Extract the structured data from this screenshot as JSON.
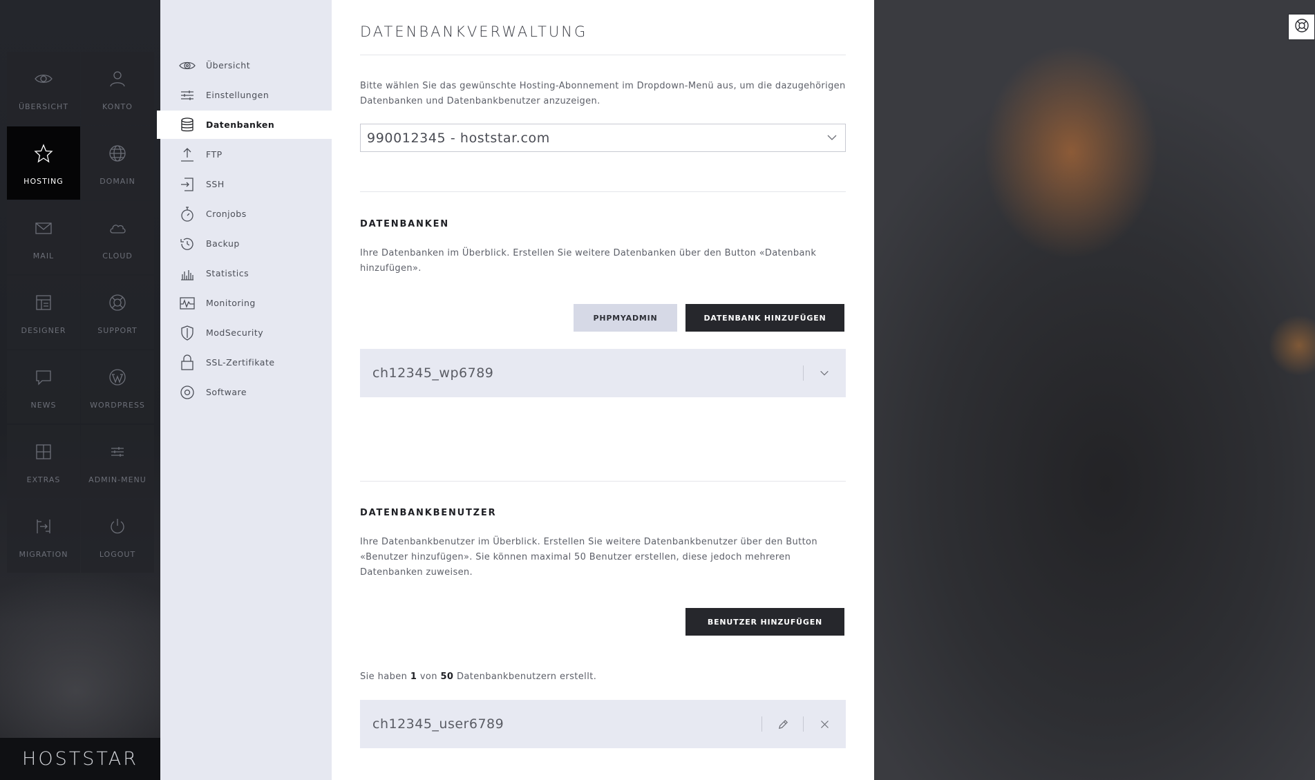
{
  "colors": {
    "accent_dark": "#26272c",
    "submenu_bg": "#e6e8f1",
    "row_bg": "#e7e9f2",
    "button_light": "#d6d9e6"
  },
  "nav": {
    "tiles": [
      {
        "label": "ÜBERSICHT",
        "icon": "eye-icon"
      },
      {
        "label": "KONTO",
        "icon": "user-icon"
      },
      {
        "label": "HOSTING",
        "icon": "star-icon",
        "active": true
      },
      {
        "label": "DOMAIN",
        "icon": "globe-icon"
      },
      {
        "label": "MAIL",
        "icon": "envelope-icon"
      },
      {
        "label": "CLOUD",
        "icon": "cloud-icon"
      },
      {
        "label": "DESIGNER",
        "icon": "layout-icon"
      },
      {
        "label": "SUPPORT",
        "icon": "lifebuoy-icon"
      },
      {
        "label": "NEWS",
        "icon": "speech-bubble-icon"
      },
      {
        "label": "WORDPRESS",
        "icon": "wordpress-icon"
      },
      {
        "label": "EXTRAS",
        "icon": "grid-plus-icon"
      },
      {
        "label": "ADMIN-MENU",
        "icon": "sliders-icon"
      },
      {
        "label": "MIGRATION",
        "icon": "migration-icon"
      },
      {
        "label": "LOGOUT",
        "icon": "power-icon"
      }
    ],
    "brand": "HOSTSTAR"
  },
  "submenu": {
    "items": [
      {
        "label": "Übersicht",
        "icon": "eye-icon"
      },
      {
        "label": "Einstellungen",
        "icon": "sliders-icon"
      },
      {
        "label": "Datenbanken",
        "icon": "database-icon",
        "active": true
      },
      {
        "label": "FTP",
        "icon": "upload-icon"
      },
      {
        "label": "SSH",
        "icon": "login-icon"
      },
      {
        "label": "Cronjobs",
        "icon": "stopwatch-icon"
      },
      {
        "label": "Backup",
        "icon": "history-icon"
      },
      {
        "label": "Statistics",
        "icon": "bar-chart-icon"
      },
      {
        "label": "Monitoring",
        "icon": "pulse-icon"
      },
      {
        "label": "ModSecurity",
        "icon": "shield-icon"
      },
      {
        "label": "SSL-Zertifikate",
        "icon": "lock-icon"
      },
      {
        "label": "Software",
        "icon": "target-icon"
      }
    ]
  },
  "main": {
    "title": "DATENBANKVERWALTUNG",
    "intro": "Bitte wählen Sie das gewünschte Hosting-Abonnement im Dropdown-Menü aus, um die dazugehörigen Datenbanken und Datenbankbenutzer anzuzeigen.",
    "subscription_select": {
      "value": "990012345 - hoststar.com"
    },
    "databases": {
      "heading": "DATENBANKEN",
      "description": "Ihre Datenbanken im Überblick. Erstellen Sie weitere Datenbanken über den Button «Datenbank hinzufügen».",
      "phpmyadmin_label": "PHPMYADMIN",
      "add_label": "DATENBANK HINZUFÜGEN",
      "items": [
        {
          "name": "ch12345_wp6789"
        }
      ]
    },
    "users": {
      "heading": "DATENBANKBENUTZER",
      "description": "Ihre Datenbankbenutzer im Überblick. Erstellen Sie weitere Datenbankbenutzer über den Button «Benutzer hinzufügen». Sie können maximal 50 Benutzer erstellen, diese jedoch mehreren Datenbanken zuweisen.",
      "add_label": "BENUTZER HINZUFÜGEN",
      "counter_prefix": "Sie haben",
      "counter_current": "1",
      "counter_mid": "von",
      "counter_max": "50",
      "counter_suffix": "Datenbankbenutzern erstellt.",
      "items": [
        {
          "name": "ch12345_user6789"
        }
      ]
    }
  }
}
